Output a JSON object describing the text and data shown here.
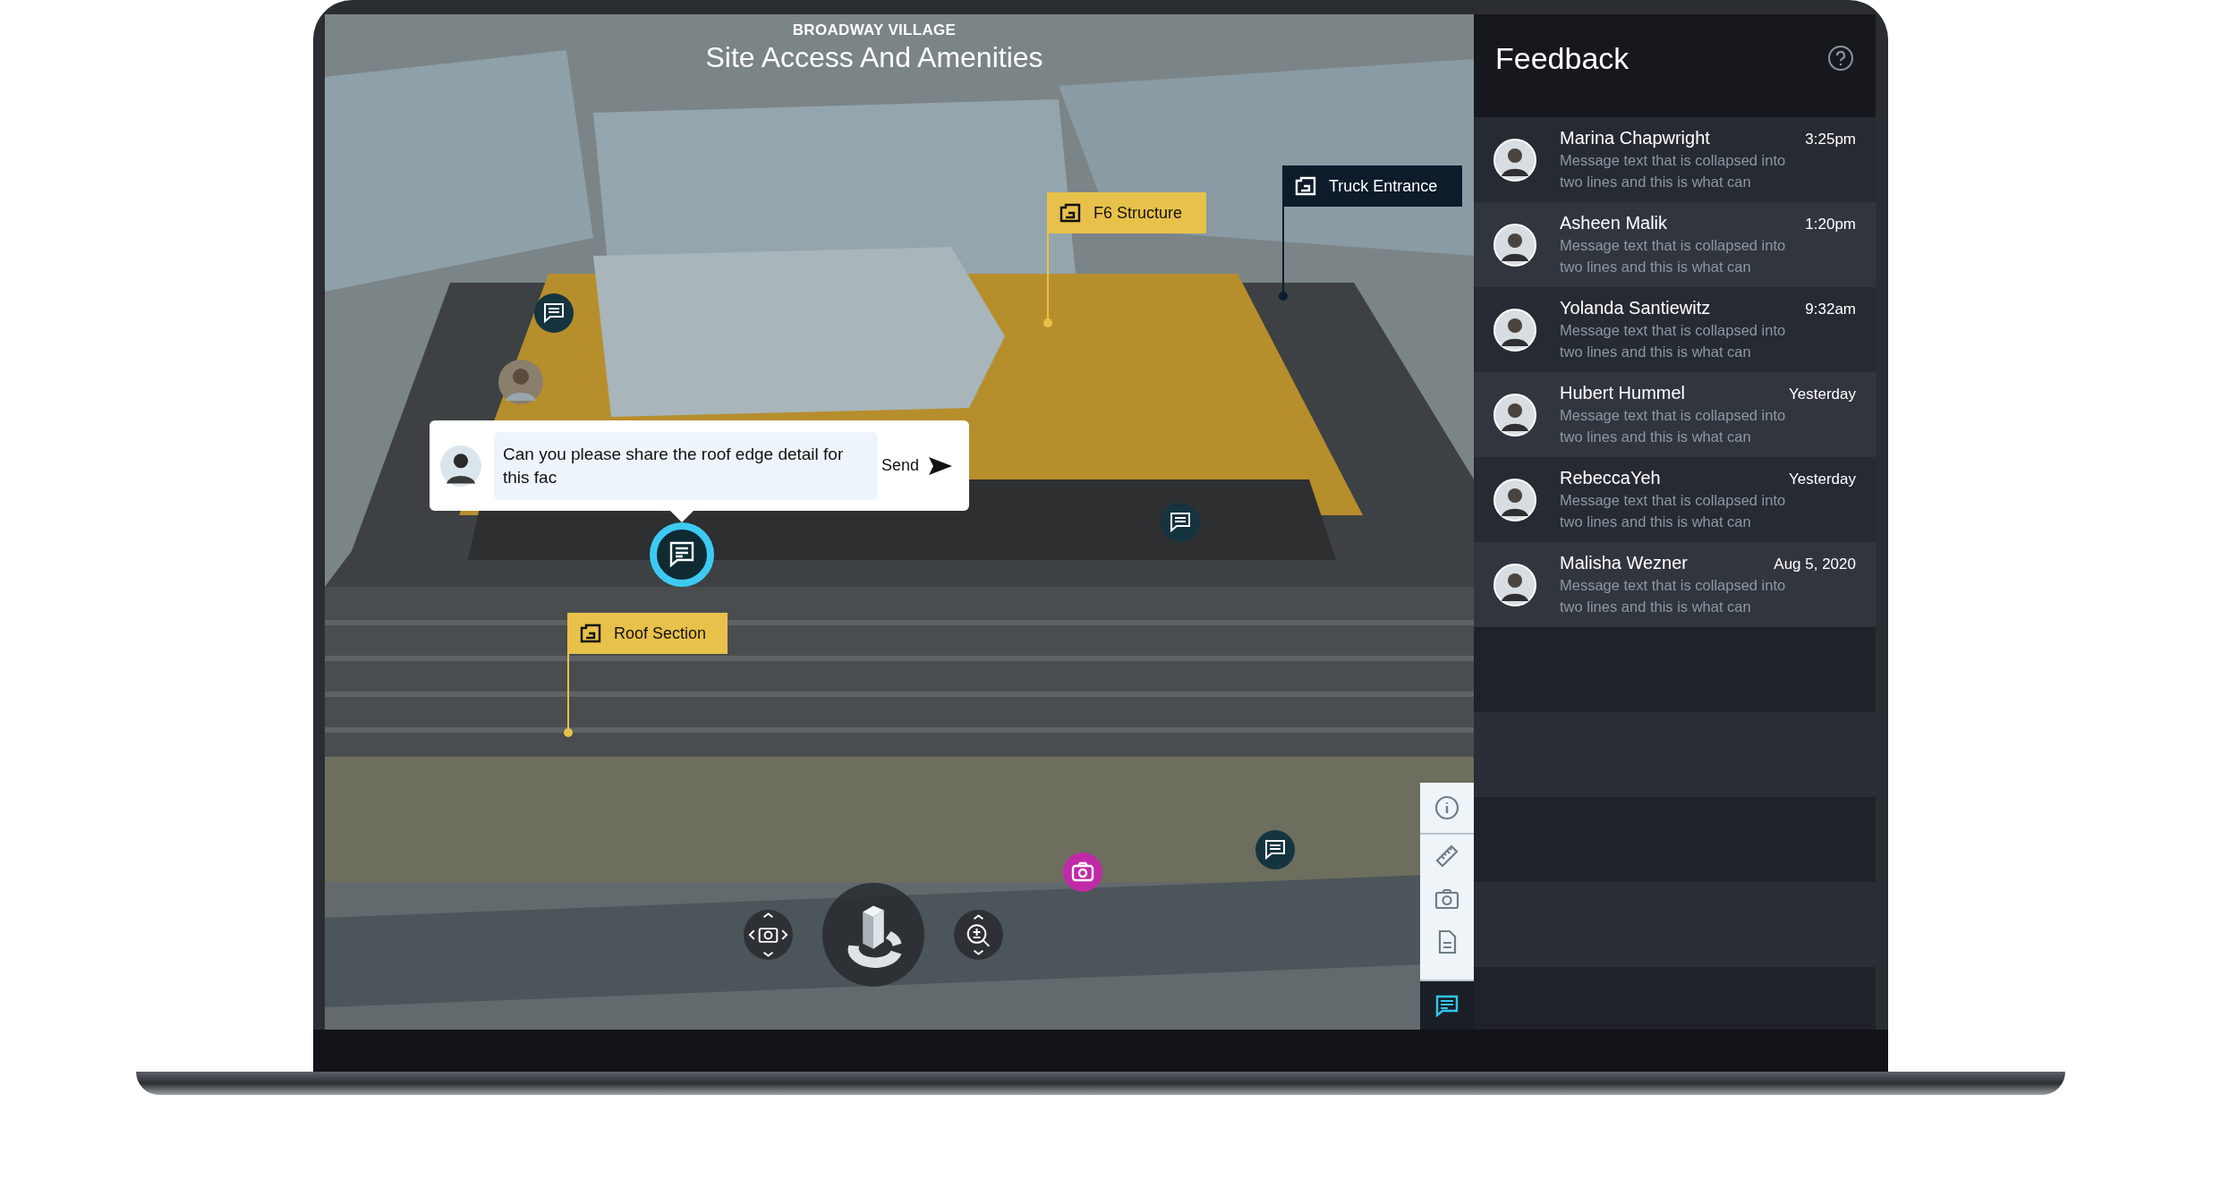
{
  "project": {
    "subtitle": "BROADWAY VILLAGE",
    "title": "Site Access And Amenities"
  },
  "labels": [
    {
      "text": "Truck Entrance",
      "kind": "dark"
    },
    {
      "text": "F6 Structure",
      "kind": "yellow"
    },
    {
      "text": "Roof Section",
      "kind": "yellow"
    }
  ],
  "comment_box": {
    "value": "Can you please share the roof edge detail for this fac",
    "send": "Send"
  },
  "tools": [
    {
      "kind": "info",
      "selected": false
    },
    {
      "kind": "measure",
      "selected": false
    },
    {
      "kind": "camera",
      "selected": false
    },
    {
      "kind": "document",
      "selected": false
    },
    {
      "kind": "comments",
      "selected": true
    }
  ],
  "feedback": {
    "title": "Feedback",
    "messages": [
      {
        "name": "Marina Chapwright",
        "time": "3:25pm",
        "text": "Message text that is collapsed into two lines and this is what can"
      },
      {
        "name": "Asheen Malik",
        "time": "1:20pm",
        "text": "Message text that is collapsed into two lines and this is what can"
      },
      {
        "name": "Yolanda Santiewitz",
        "time": "9:32am",
        "text": "Message text that is collapsed into two lines and this is what can"
      },
      {
        "name": "Hubert Hummel",
        "time": "Yesterday",
        "text": "Message text that is collapsed into two lines and this is what can"
      },
      {
        "name": "RebeccaYeh",
        "time": "Yesterday",
        "text": "Message text that is collapsed into two lines and this is what can"
      },
      {
        "name": "Malisha Wezner",
        "time": "Aug 5, 2020",
        "text": "Message text that is collapsed into two lines and this is what can"
      }
    ]
  }
}
